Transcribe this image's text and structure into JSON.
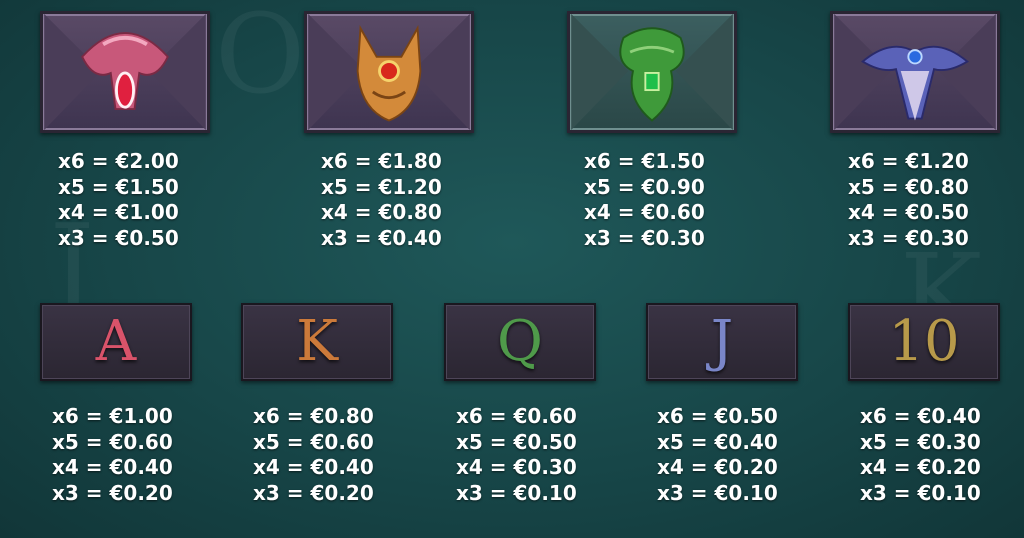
{
  "premium_symbols": [
    {
      "icon": "pink-gem-snake-icon",
      "pays": [
        "x6 = €2.00",
        "x5 = €1.50",
        "x4 = €1.00",
        "x3 = €0.50"
      ]
    },
    {
      "icon": "orange-gem-fox-icon",
      "pays": [
        "x6 = €1.80",
        "x5 = €1.20",
        "x4 = €0.80",
        "x3 = €0.40"
      ]
    },
    {
      "icon": "green-gem-idol-icon",
      "pays": [
        "x6 = €1.50",
        "x5 = €0.90",
        "x4 = €0.60",
        "x3 = €0.30"
      ]
    },
    {
      "icon": "blue-gem-raven-icon",
      "pays": [
        "x6 = €1.20",
        "x5 = €0.80",
        "x4 = €0.50",
        "x3 = €0.30"
      ]
    }
  ],
  "royal_symbols": [
    {
      "label": "A",
      "color": "#d9536a",
      "pays": [
        "x6 = €1.00",
        "x5 = €0.60",
        "x4 = €0.40",
        "x3 = €0.20"
      ]
    },
    {
      "label": "K",
      "color": "#cc7a3a",
      "pays": [
        "x6 = €0.80",
        "x5 = €0.60",
        "x4 = €0.40",
        "x3 = €0.20"
      ]
    },
    {
      "label": "Q",
      "color": "#4f9a4a",
      "pays": [
        "x6 = €0.60",
        "x5 = €0.50",
        "x4 = €0.30",
        "x3 = €0.10"
      ]
    },
    {
      "label": "J",
      "color": "#7a86c8",
      "pays": [
        "x6 = €0.50",
        "x5 = €0.40",
        "x4 = €0.20",
        "x3 = €0.10"
      ]
    },
    {
      "label": "10",
      "color": "#b89a4a",
      "pays": [
        "x6 = €0.40",
        "x5 = €0.30",
        "x4 = €0.20",
        "x3 = €0.10"
      ]
    }
  ]
}
